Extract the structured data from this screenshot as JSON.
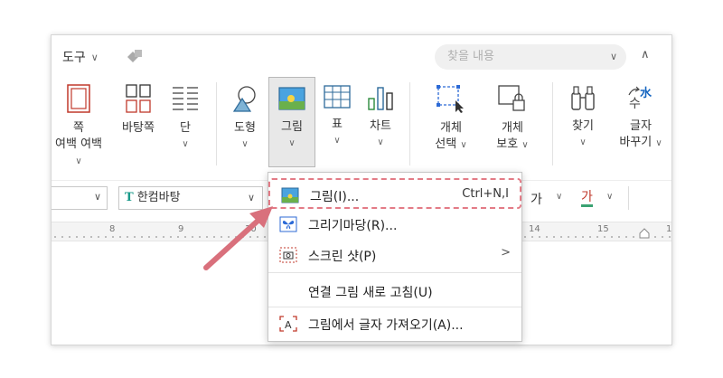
{
  "topbar": {
    "tool_label": "도구",
    "search_placeholder": "찾을 내용"
  },
  "ribbon": {
    "margin": "쪽\n여백",
    "background": "바탕쪽",
    "columns": "단",
    "shape": "도형",
    "picture": "그림",
    "table": "표",
    "chart": "차트",
    "object_select_1": "개체",
    "object_select_2": "선택",
    "object_protect_1": "개체",
    "object_protect_2": "보호",
    "find": "찾기",
    "replace_1": "글자",
    "replace_2": "바꾸기"
  },
  "formatbar": {
    "font_name": "한컴바탕",
    "char_ga_1": "가",
    "char_ga_2": "가"
  },
  "ruler": {
    "marks": [
      "8",
      "9",
      "10",
      "14",
      "15",
      "1"
    ]
  },
  "menu": {
    "items": [
      {
        "label": "그림(I)...",
        "shortcut": "Ctrl+N,I"
      },
      {
        "label": "그리기마당(R)..."
      },
      {
        "label": "스크린 샷(P)"
      },
      {
        "label": "연결 그림 새로 고침(U)"
      },
      {
        "label": "그림에서 글자 가져오기(A)..."
      }
    ]
  },
  "colors": {
    "highlight_dash": "#e37b86",
    "arrow": "#d9707c",
    "accent_blue": "#1565c0"
  }
}
